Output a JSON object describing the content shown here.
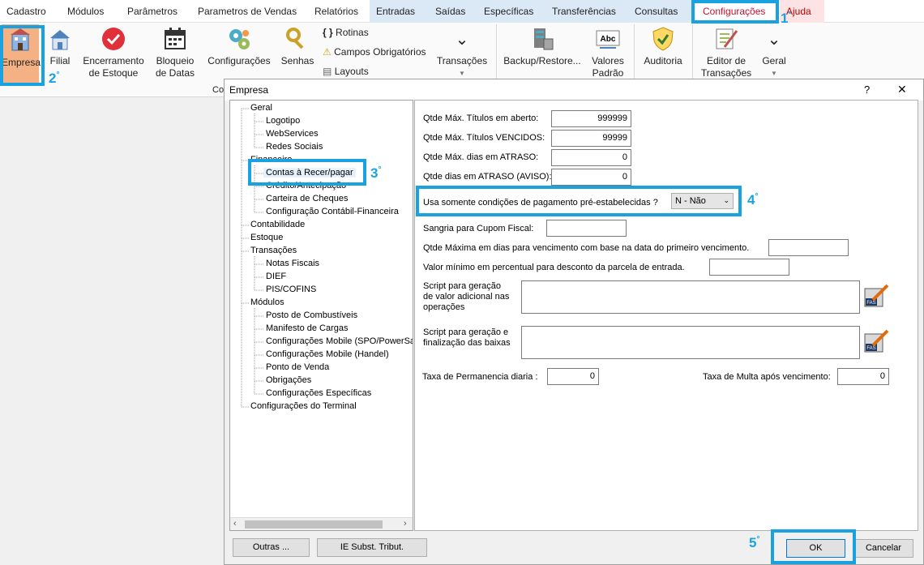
{
  "menu": {
    "items": [
      "Cadastro",
      "Módulos",
      "Parâmetros",
      "Parametros de Vendas",
      "Relatórios",
      "Entradas",
      "Saídas",
      "Específicas",
      "Transferências",
      "Consultas",
      "Configurações",
      "Ajuda"
    ]
  },
  "ribbon": {
    "empresa": "Empresa",
    "filial": "Filial",
    "encerramento_1": "Encerramento",
    "encerramento_2": "de Estoque",
    "bloqueio_1": "Bloqueio",
    "bloqueio_2": "de Datas",
    "configuracoes": "Configurações",
    "senhas": "Senhas",
    "rotinas": "Rotinas",
    "campos_obrigatorios": "Campos Obrigatórios",
    "layouts": "Layouts",
    "transacoes": "Transações",
    "backup": "Backup/Restore...",
    "valores_1": "Valores",
    "valores_2": "Padrão",
    "auditoria": "Auditoria",
    "editor_1": "Editor de",
    "editor_2": "Transações",
    "geral": "Geral",
    "group_label": "Co"
  },
  "annotations": {
    "n1": "1",
    "n2": "2",
    "n3": "3",
    "n4": "4",
    "n5": "5",
    "degree": "°"
  },
  "dialog": {
    "title": "Empresa",
    "help": "?",
    "close": "✕",
    "tree": [
      {
        "label": "Geral",
        "level": 0
      },
      {
        "label": "Logotipo",
        "level": 1
      },
      {
        "label": "WebServices",
        "level": 1
      },
      {
        "label": "Redes Sociais",
        "level": 1
      },
      {
        "label": "Financeiro",
        "level": 0
      },
      {
        "label": "Contas à Recer/pagar",
        "level": 1
      },
      {
        "label": "Crédito/Antecipação",
        "level": 1
      },
      {
        "label": "Carteira de Cheques",
        "level": 1
      },
      {
        "label": "Configuração Contábil-Financeira",
        "level": 1
      },
      {
        "label": "Contabilidade",
        "level": 0
      },
      {
        "label": "Estoque",
        "level": 0
      },
      {
        "label": "Transações",
        "level": 0
      },
      {
        "label": "Notas Fiscais",
        "level": 1
      },
      {
        "label": "DIEF",
        "level": 1
      },
      {
        "label": "PIS/COFINS",
        "level": 1
      },
      {
        "label": "Módulos",
        "level": 0
      },
      {
        "label": "Posto de Combustíveis",
        "level": 1
      },
      {
        "label": "Manifesto de Cargas",
        "level": 1
      },
      {
        "label": "Configurações Mobile (SPO/PowerSa",
        "level": 1
      },
      {
        "label": "Configurações Mobile (Handel)",
        "level": 1
      },
      {
        "label": "Ponto de Venda",
        "level": 1
      },
      {
        "label": "Obrigações",
        "level": 1
      },
      {
        "label": "Configurações Específicas",
        "level": 1
      },
      {
        "label": "Configurações do Terminal",
        "level": 0
      }
    ],
    "fields": {
      "max_titulos_label": "Qtde Máx. Títulos em aberto:",
      "max_titulos_value": "999999",
      "max_vencidos_label": "Qtde Máx. Títulos VENCIDOS:",
      "max_vencidos_value": "99999",
      "max_dias_label": "Qtde Máx. dias em ATRASO:",
      "max_dias_value": "0",
      "dias_aviso_label": "Qtde dias em ATRASO (AVISO):",
      "dias_aviso_value": "0",
      "condicoes_label": "Usa somente condições de pagamento pré-estabelecidas ?",
      "condicoes_value": "N - Não",
      "sangria_label": "Sangria para Cupom Fiscal:",
      "qtde_max_dias_label": "Qtde Máxima em dias para vencimento com base na data do primeiro vencimento.",
      "valor_min_label": "Valor mínimo em percentual para desconto da parcela de entrada.",
      "script1_l1": "Script para geração",
      "script1_l2": "de valor adicional nas",
      "script1_l3": "operações",
      "script2_l1": "Script para geração e",
      "script2_l2": "finalização das baixas",
      "taxa_perm_label": "Taxa de Permanencia diaria :",
      "taxa_perm_value": "0",
      "taxa_multa_label": "Taxa de Multa após vencimento:",
      "taxa_multa_value": "0",
      "script_icon_text": "FAS"
    },
    "buttons": {
      "outras": "Outras ...",
      "ie_subst": "IE Subst. Tribut.",
      "ok": "OK",
      "cancelar": "Cancelar"
    }
  },
  "colors": {
    "highlight": "#1aa2e0",
    "active_menu": "#c8102e",
    "selected_ribbon": "#f4b183"
  }
}
